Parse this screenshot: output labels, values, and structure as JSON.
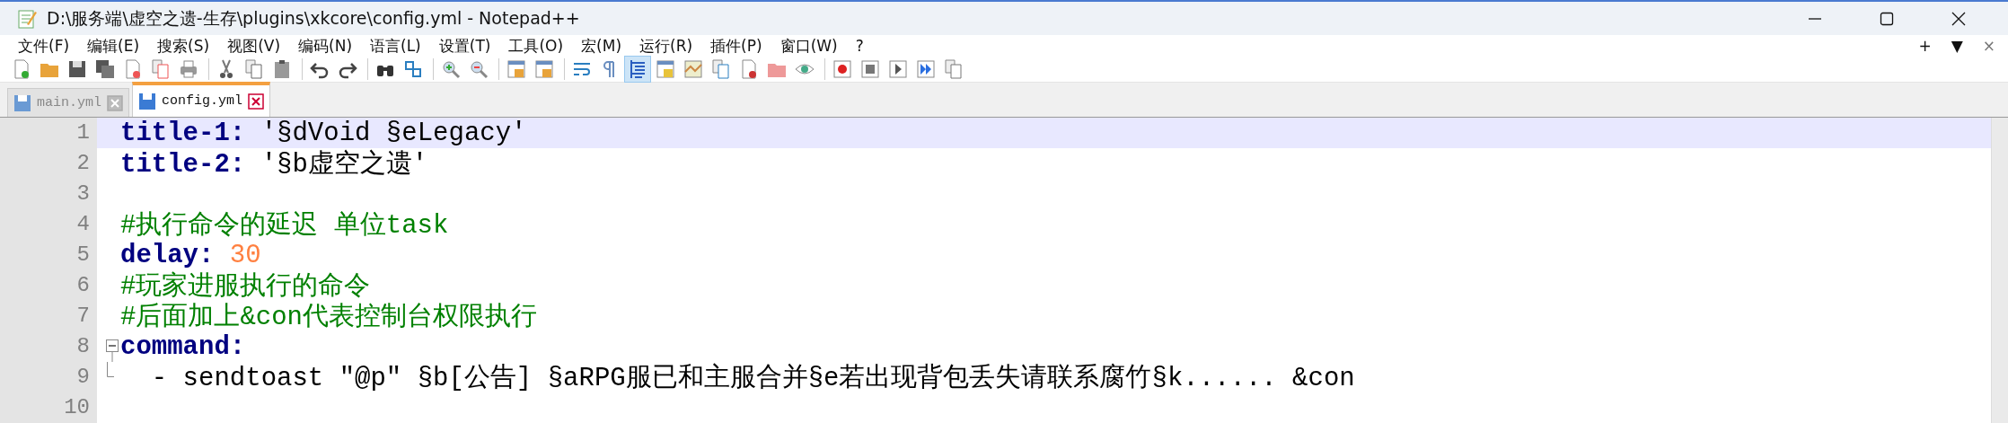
{
  "window": {
    "title": "D:\\服务端\\虚空之遗-生存\\plugins\\xkcore\\config.yml - Notepad++"
  },
  "menu": [
    "文件(F)",
    "编辑(E)",
    "搜索(S)",
    "视图(V)",
    "编码(N)",
    "语言(L)",
    "设置(T)",
    "工具(O)",
    "宏(M)",
    "运行(R)",
    "插件(P)",
    "窗口(W)",
    "?"
  ],
  "menu_right": [
    "+",
    "▼",
    "×"
  ],
  "tabs": [
    {
      "label": "main.yml",
      "selected": false
    },
    {
      "label": "config.yml",
      "selected": true
    }
  ],
  "editor": {
    "lines": [
      {
        "number": "1",
        "current": true,
        "fold_start": false,
        "fold_end": false,
        "tokens": [
          {
            "kind": "key",
            "text": "title-1"
          },
          {
            "kind": "punct",
            "text": ": "
          },
          {
            "kind": "plain",
            "text": "'§dVoid §eLegacy'"
          }
        ]
      },
      {
        "number": "2",
        "current": false,
        "fold_start": false,
        "fold_end": false,
        "tokens": [
          {
            "kind": "key",
            "text": "title-2"
          },
          {
            "kind": "punct",
            "text": ": "
          },
          {
            "kind": "plain",
            "text": "'§b虚空之遗'"
          }
        ]
      },
      {
        "number": "3",
        "current": false,
        "fold_start": false,
        "fold_end": false
      },
      {
        "number": "4",
        "current": false,
        "fold_start": false,
        "fold_end": false,
        "tokens": [
          {
            "kind": "comment",
            "text": "#执行命令的延迟 单位task"
          }
        ]
      },
      {
        "number": "5",
        "current": false,
        "fold_start": false,
        "fold_end": false,
        "tokens": [
          {
            "kind": "key",
            "text": "delay"
          },
          {
            "kind": "punct",
            "text": ": "
          },
          {
            "kind": "number",
            "text": "30"
          }
        ]
      },
      {
        "number": "6",
        "current": false,
        "fold_start": false,
        "fold_end": false,
        "tokens": [
          {
            "kind": "comment",
            "text": "#玩家进服执行的命令"
          }
        ]
      },
      {
        "number": "7",
        "current": false,
        "fold_start": false,
        "fold_end": false,
        "tokens": [
          {
            "kind": "comment",
            "text": "#后面加上&con代表控制台权限执行"
          }
        ]
      },
      {
        "number": "8",
        "current": false,
        "fold_start": true,
        "fold_end": false,
        "tokens": [
          {
            "kind": "key",
            "text": "command"
          },
          {
            "kind": "punct",
            "text": ":"
          }
        ]
      },
      {
        "number": "9",
        "current": false,
        "fold_start": false,
        "fold_end": true,
        "tokens": [
          {
            "kind": "plain",
            "text": "  - sendtoast \"@p\" §b[公告] §aRPG服已和主服合并§e若出现背包丢失请联系腐竹§k...... &con"
          }
        ]
      },
      {
        "number": "10",
        "current": false,
        "fold_start": false,
        "fold_end": false
      }
    ]
  }
}
